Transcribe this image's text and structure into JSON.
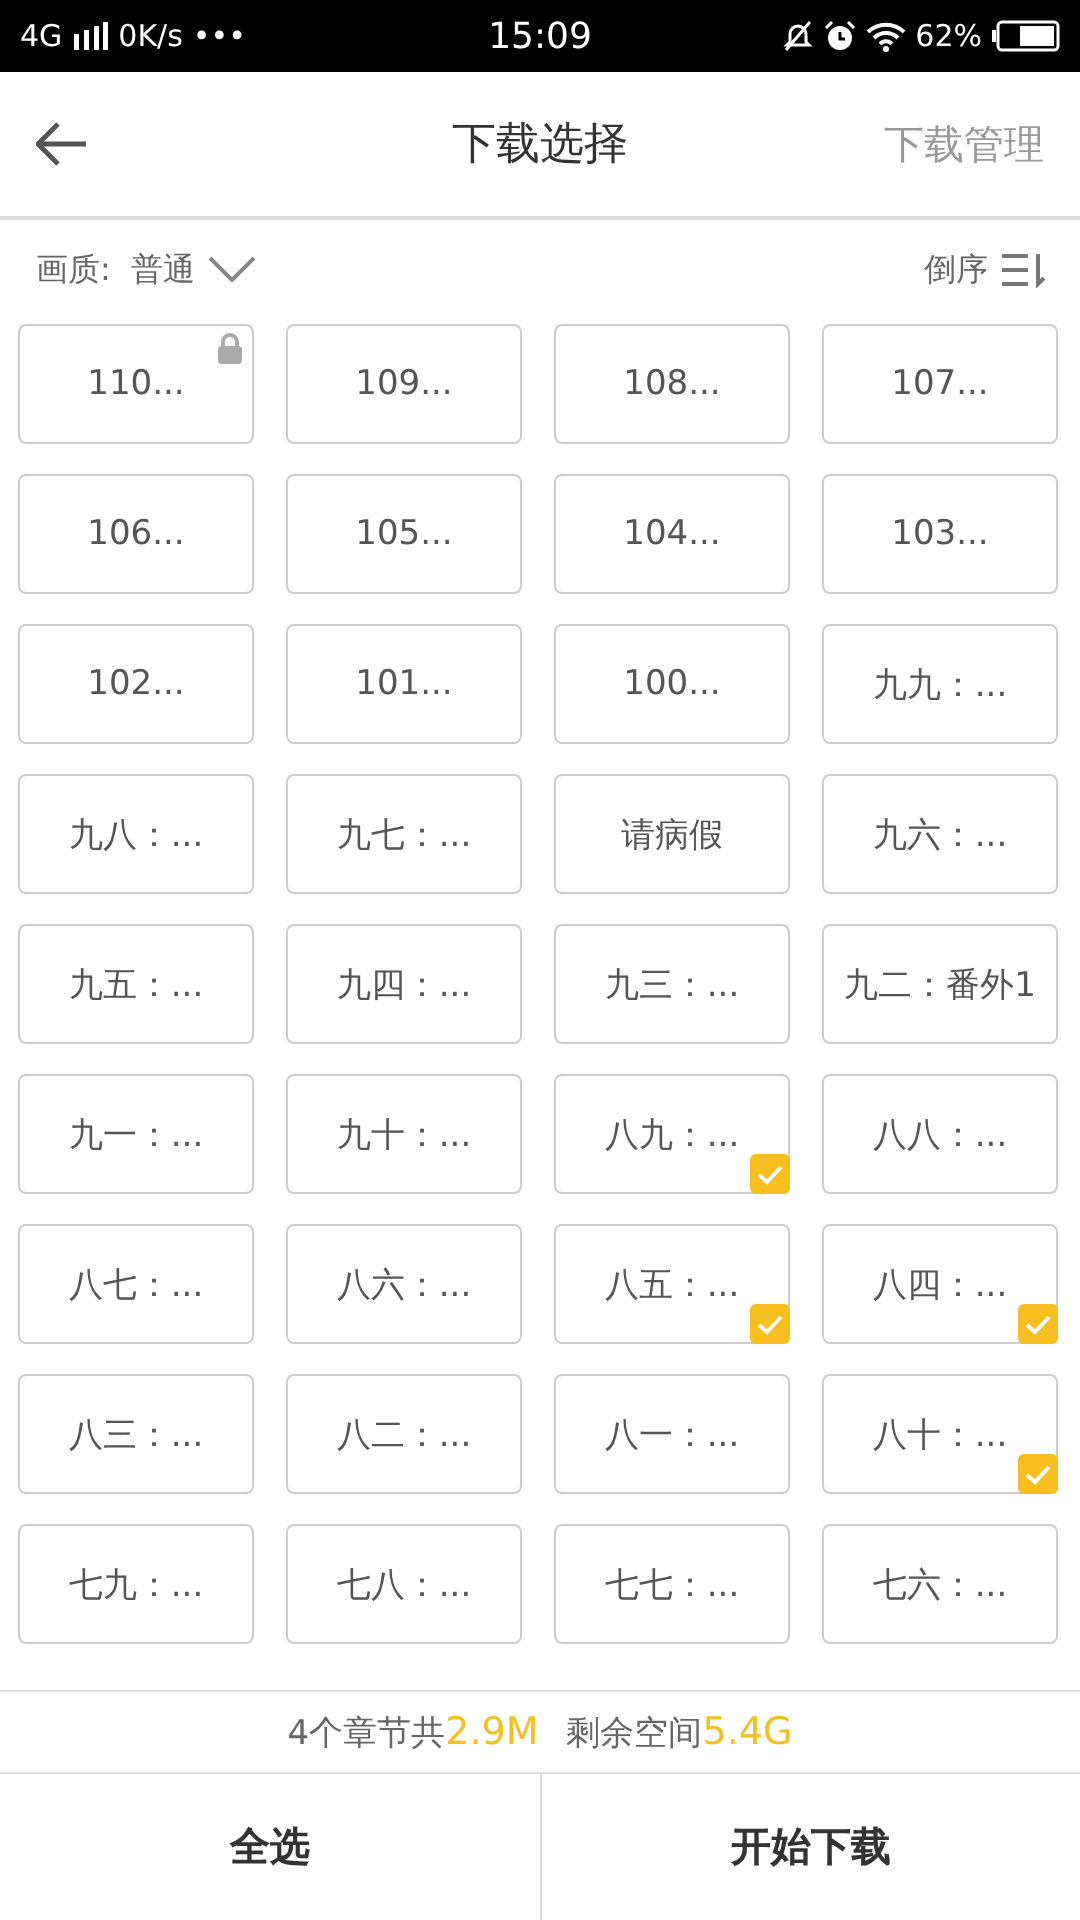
{
  "status_bar": {
    "network": "4G",
    "speed": "0K/s",
    "more": "•••",
    "time": "15:09",
    "battery": "62%"
  },
  "header": {
    "title": "下载选择",
    "action": "下载管理"
  },
  "filter": {
    "quality_label": "画质:",
    "quality_value": "普通",
    "sort_label": "倒序"
  },
  "chapters": [
    {
      "label": "110...",
      "locked": true,
      "checked": false
    },
    {
      "label": "109...",
      "locked": false,
      "checked": false
    },
    {
      "label": "108...",
      "locked": false,
      "checked": false
    },
    {
      "label": "107...",
      "locked": false,
      "checked": false
    },
    {
      "label": "106...",
      "locked": false,
      "checked": false
    },
    {
      "label": "105...",
      "locked": false,
      "checked": false
    },
    {
      "label": "104...",
      "locked": false,
      "checked": false
    },
    {
      "label": "103...",
      "locked": false,
      "checked": false
    },
    {
      "label": "102...",
      "locked": false,
      "checked": false
    },
    {
      "label": "101...",
      "locked": false,
      "checked": false
    },
    {
      "label": "100...",
      "locked": false,
      "checked": false
    },
    {
      "label": "九九：...",
      "locked": false,
      "checked": false
    },
    {
      "label": "九八：...",
      "locked": false,
      "checked": false
    },
    {
      "label": "九七：...",
      "locked": false,
      "checked": false
    },
    {
      "label": "请病假",
      "locked": false,
      "checked": false
    },
    {
      "label": "九六：...",
      "locked": false,
      "checked": false
    },
    {
      "label": "九五：...",
      "locked": false,
      "checked": false
    },
    {
      "label": "九四：...",
      "locked": false,
      "checked": false
    },
    {
      "label": "九三：...",
      "locked": false,
      "checked": false
    },
    {
      "label": "九二：番外1",
      "locked": false,
      "checked": false
    },
    {
      "label": "九一：...",
      "locked": false,
      "checked": false
    },
    {
      "label": "九十：...",
      "locked": false,
      "checked": false
    },
    {
      "label": "八九：...",
      "locked": false,
      "checked": true
    },
    {
      "label": "八八：...",
      "locked": false,
      "checked": false
    },
    {
      "label": "八七：...",
      "locked": false,
      "checked": false
    },
    {
      "label": "八六：...",
      "locked": false,
      "checked": false
    },
    {
      "label": "八五：...",
      "locked": false,
      "checked": true
    },
    {
      "label": "八四：...",
      "locked": false,
      "checked": true
    },
    {
      "label": "八三：...",
      "locked": false,
      "checked": false
    },
    {
      "label": "八二：...",
      "locked": false,
      "checked": false
    },
    {
      "label": "八一：...",
      "locked": false,
      "checked": false
    },
    {
      "label": "八十：...",
      "locked": false,
      "checked": true
    },
    {
      "label": "七九：...",
      "locked": false,
      "checked": false
    },
    {
      "label": "七八：...",
      "locked": false,
      "checked": false
    },
    {
      "label": "七七：...",
      "locked": false,
      "checked": false
    },
    {
      "label": "七六：...",
      "locked": false,
      "checked": false
    }
  ],
  "summary": {
    "count_text": "4个章节共",
    "size": "2.9M",
    "space_label": "剩余空间",
    "space": "5.4G"
  },
  "buttons": [
    "全选",
    "开始下载"
  ]
}
